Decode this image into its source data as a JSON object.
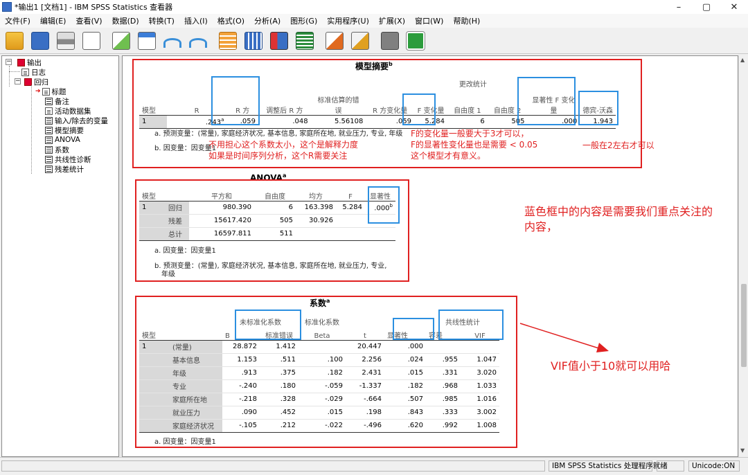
{
  "window": {
    "title": "*输出1 [文档1] - IBM SPSS Statistics 查看器",
    "controls": [
      "–",
      "▢",
      "✕"
    ]
  },
  "menu": [
    "文件(F)",
    "编辑(E)",
    "查看(V)",
    "数据(D)",
    "转换(T)",
    "插入(I)",
    "格式(O)",
    "分析(A)",
    "图形(G)",
    "实用程序(U)",
    "扩展(X)",
    "窗口(W)",
    "帮助(H)"
  ],
  "toolbar_icons": [
    "open-folder-icon",
    "save-icon",
    "print-icon",
    "print-preview-icon",
    "export-icon",
    "recall-dialog-icon",
    "undo-icon",
    "redo-icon",
    "goto-data-icon",
    "goto-case-icon",
    "variables-icon",
    "select-cases-icon",
    "insert-output-icon",
    "designate-window-icon",
    "show-all-icon",
    "add-icon"
  ],
  "outline": {
    "root": "输出",
    "log": "日志",
    "regression": "回归",
    "items": [
      "标题",
      "备注",
      "活动数据集",
      "输入/除去的变量",
      "模型摘要",
      "ANOVA",
      "系数",
      "共线性诊断",
      "残差统计"
    ]
  },
  "model_summary": {
    "title": "模型摘要",
    "title_sup": "b",
    "change_stats_header": "更改统计",
    "headers": {
      "model": "模型",
      "r": "R",
      "r2": "R 方",
      "adj_r2": "调整后 R 方",
      "se_line1": "标准估算的错",
      "se_line2": "误",
      "r2_change": "R 方变化量",
      "f_change": "F 变化量",
      "df1": "自由度 1",
      "df2": "自由度 2",
      "sig_f_line1": "显著性 F 变化",
      "sig_f_line2": "量",
      "dw": "德宾-沃森"
    },
    "row": {
      "model": "1",
      "r": ".243",
      "r_sup": "a",
      "r2": ".059",
      "adj_r2": ".048",
      "se": "5.56108",
      "r2_change": ".059",
      "f_change": "5.284",
      "df1": "6",
      "df2": "505",
      "sig_f": ".000",
      "dw": "1.943"
    },
    "note_a": "a. 预测变量：(常量), 家庭经济状况, 基本信息, 家庭所在地, 就业压力, 专业, 年级",
    "note_b": "b. 因变量：因变量1"
  },
  "anova": {
    "title": "ANOVA",
    "title_sup": "a",
    "headers": {
      "model": "模型",
      "ss": "平方和",
      "df": "自由度",
      "ms": "均方",
      "f": "F",
      "sig": "显著性"
    },
    "model": "1",
    "rows": [
      {
        "label": "回归",
        "ss": "980.390",
        "df": "6",
        "ms": "163.398",
        "f": "5.284",
        "sig": ".000",
        "sig_sup": "b"
      },
      {
        "label": "残差",
        "ss": "15617.420",
        "df": "505",
        "ms": "30.926",
        "f": "",
        "sig": "",
        "sig_sup": ""
      },
      {
        "label": "总计",
        "ss": "16597.811",
        "df": "511",
        "ms": "",
        "f": "",
        "sig": "",
        "sig_sup": ""
      }
    ],
    "note_a": "a. 因变量：因变量1",
    "note_b_line1": "b. 预测变量：(常量), 家庭经济状况, 基本信息, 家庭所在地, 就业压力, 专业,",
    "note_b_line2": "年级"
  },
  "coefficients": {
    "title": "系数",
    "title_sup": "a",
    "headers": {
      "model": "模型",
      "unstd": "未标准化系数",
      "b": "B",
      "se": "标准错误",
      "std": "标准化系数",
      "beta": "Beta",
      "t": "t",
      "sig": "显著性",
      "collin": "共线性统计",
      "tol": "容差",
      "vif": "VIF"
    },
    "model": "1",
    "rows": [
      {
        "label": "(常量)",
        "b": "28.872",
        "se": "1.412",
        "beta": "",
        "t": "20.447",
        "sig": ".000",
        "tol": "",
        "vif": ""
      },
      {
        "label": "基本信息",
        "b": "1.153",
        "se": ".511",
        "beta": ".100",
        "t": "2.256",
        "sig": ".024",
        "tol": ".955",
        "vif": "1.047"
      },
      {
        "label": "年级",
        "b": ".913",
        "se": ".375",
        "beta": ".182",
        "t": "2.431",
        "sig": ".015",
        "tol": ".331",
        "vif": "3.020"
      },
      {
        "label": "专业",
        "b": "-.240",
        "se": ".180",
        "beta": "-.059",
        "t": "-1.337",
        "sig": ".182",
        "tol": ".968",
        "vif": "1.033"
      },
      {
        "label": "家庭所在地",
        "b": "-.218",
        "se": ".328",
        "beta": "-.029",
        "t": "-.664",
        "sig": ".507",
        "tol": ".985",
        "vif": "1.016"
      },
      {
        "label": "就业压力",
        "b": ".090",
        "se": ".452",
        "beta": ".015",
        "t": ".198",
        "sig": ".843",
        "tol": ".333",
        "vif": "3.002"
      },
      {
        "label": "家庭经济状况",
        "b": "-.105",
        "se": ".212",
        "beta": "-.022",
        "t": "-.496",
        "sig": ".620",
        "tol": ".992",
        "vif": "1.008"
      }
    ],
    "note_a": "a. 因变量：因变量1"
  },
  "annotations": {
    "r2_note_line1": "不用担心这个系数太小，这个是解释力度",
    "r2_note_line2": "如果是时间序列分析，这个R需要关注",
    "f_note_line1": "F的变化量一般要大于3才可以，",
    "f_note_line2": "F的显著性变化量也是需要 < 0.05",
    "f_note_line3": "这个模型才有意义。",
    "dw_note": "一般在2左右才可以",
    "blue_note_line1": "蓝色框中的内容是需要我们重点关注的",
    "blue_note_line2": "内容，",
    "vif_note": "VIF值小于10就可以用哈"
  },
  "status": {
    "processor": "IBM SPSS Statistics 处理程序就绪",
    "unicode": "Unicode:ON"
  },
  "colors": {
    "annotation_red": "#e02020",
    "highlight_blue": "#2b8fe0",
    "row_label_gray": "#d9d9d9"
  }
}
